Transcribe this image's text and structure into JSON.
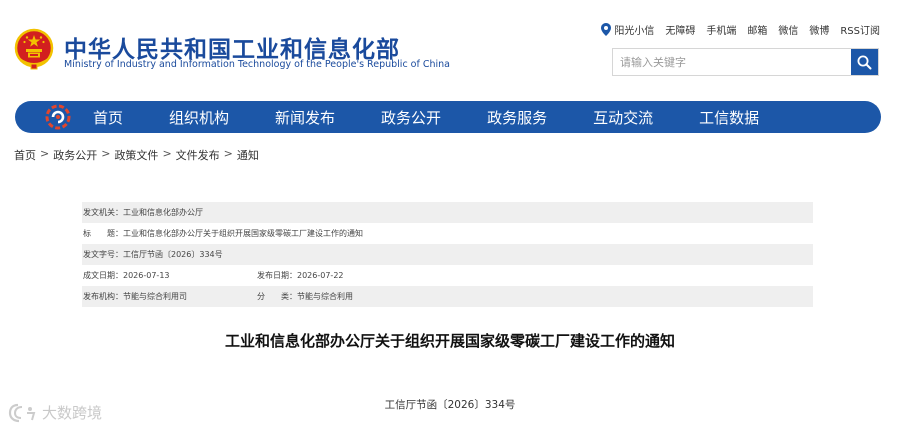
{
  "header": {
    "title_cn": "中华人民共和国工业和信息化部",
    "title_en": "Ministry of Industry and Information Technology of the People's Republic of China",
    "toplinks": [
      "阳光小信",
      "无障碍",
      "手机端",
      "邮箱",
      "微信",
      "微博",
      "RSS订阅"
    ],
    "search_placeholder": "请输入关键字"
  },
  "nav": {
    "items": [
      "首页",
      "组织机构",
      "新闻发布",
      "政务公开",
      "政务服务",
      "互动交流",
      "工信数据"
    ]
  },
  "breadcrumb": [
    "首页",
    "政务公开",
    "政策文件",
    "文件发布",
    "通知"
  ],
  "info": {
    "issuer_label": "发文机关：",
    "issuer_value": "工业和信息化部办公厅",
    "title_label": "标　　题：",
    "title_value": "工业和信息化部办公厅关于组织开展国家级零碳工厂建设工作的通知",
    "docno_label": "发文字号：",
    "docno_value": "工信厅节函〔2026〕334号",
    "created_label": "成文日期：",
    "created_value": "2026-07-13",
    "published_label": "发布日期：",
    "published_value": "2026-07-22",
    "org_label": "发布机构：",
    "org_value": "节能与综合利用司",
    "category_label": "分　　类：",
    "category_value": "节能与综合利用"
  },
  "article": {
    "title": "工业和信息化部办公厅关于组织开展国家级零碳工厂建设工作的通知",
    "doc_number": "工信厅节函〔2026〕334号"
  },
  "watermark": "大数跨境",
  "colors": {
    "primary": "#1c57a8",
    "title_blue": "#1a4a9c",
    "emblem_red": "#d21f1f",
    "emblem_gold": "#f2c200",
    "row_shade": "#efefef"
  }
}
